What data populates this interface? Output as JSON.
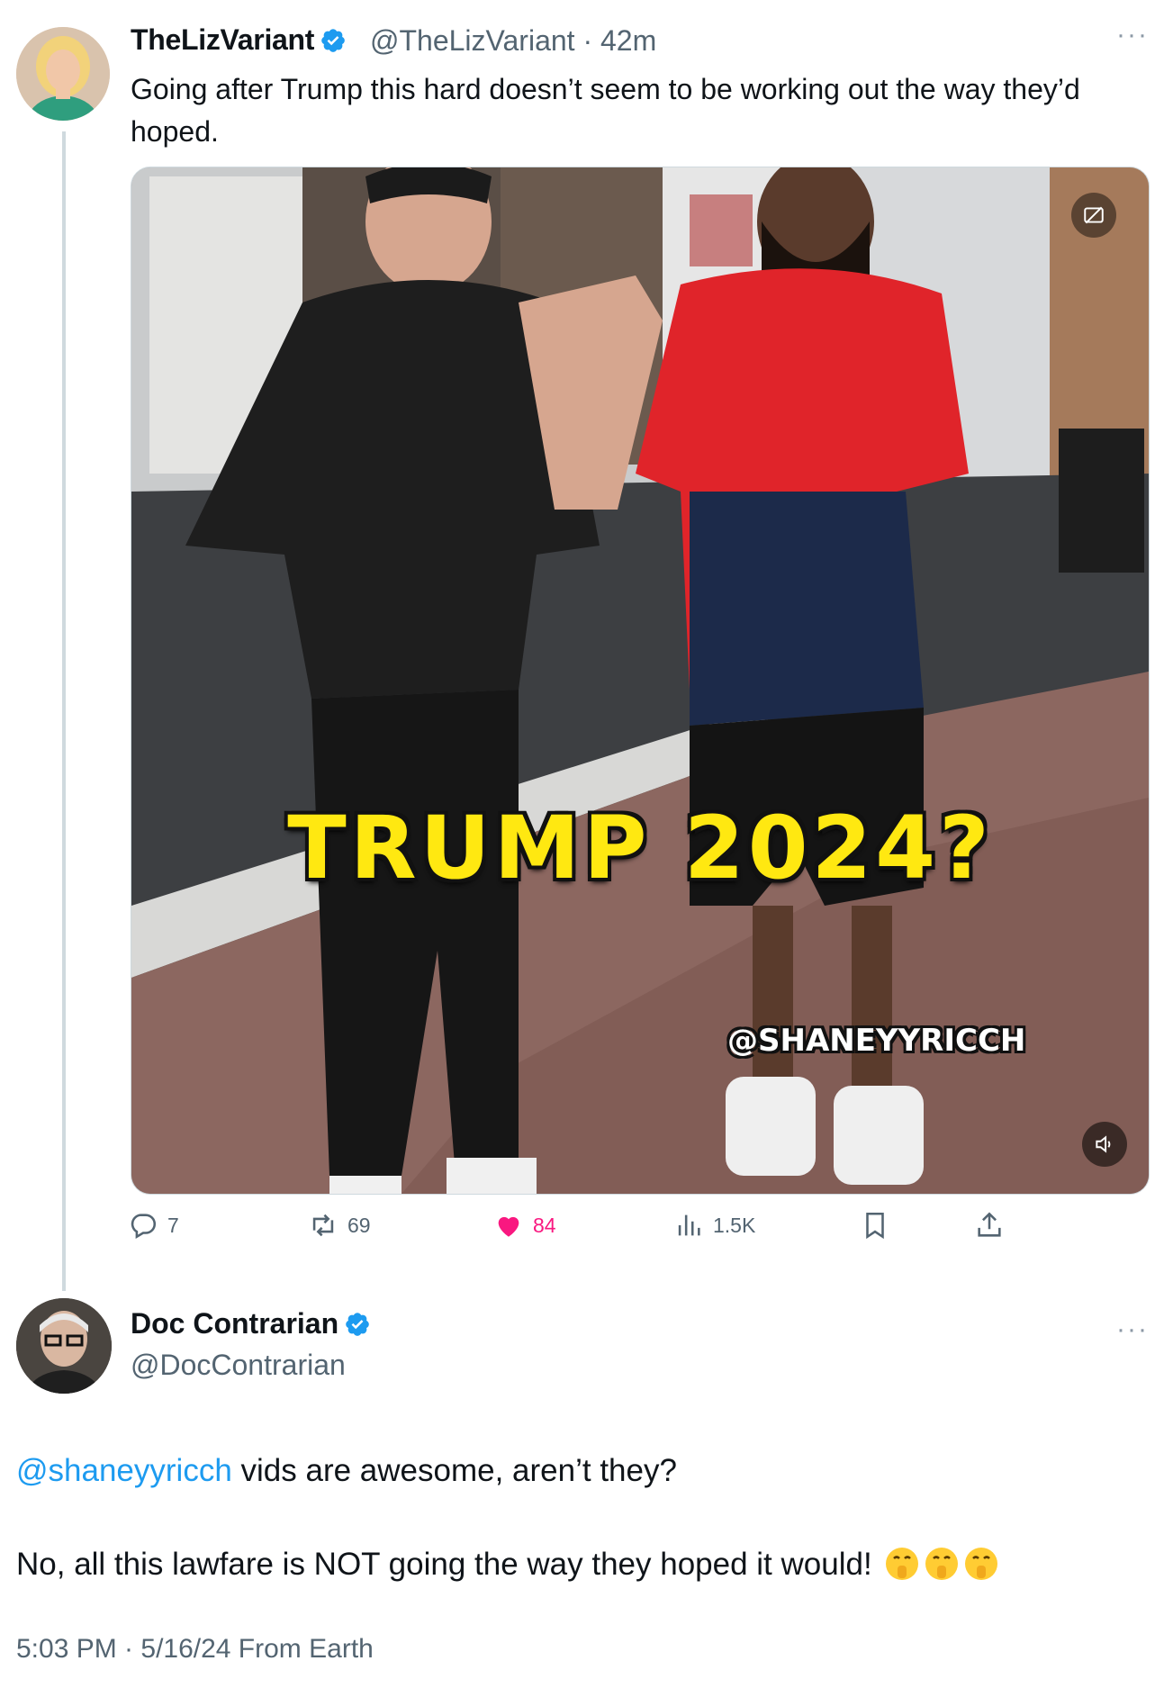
{
  "tweet1": {
    "author_name": "TheLizVariant",
    "handle": "@TheLizVariant",
    "time": "42m",
    "text": "Going after Trump this hard doesn’t seem to be working out the way they’d hoped.",
    "media": {
      "overlay_text": "TRUMP 2024?",
      "overlay_handle": "@SHANEYYRICCH"
    },
    "actions": {
      "replies": "7",
      "reposts": "69",
      "likes": "84",
      "views": "1.5K"
    }
  },
  "tweet2": {
    "author_name": "Doc Contrarian",
    "handle": "@DocContrarian",
    "mention": "@shaneyyricch",
    "text_line1_rest": " vids are awesome, aren’t they?",
    "text_line2": "No, all this lawfare is NOT going the way they hoped it would!",
    "timestamp": "5:03 PM · 5/16/24 From Earth"
  },
  "colors": {
    "link": "#1d9bf0",
    "like": "#f91880",
    "muted": "#536471",
    "verified": "#1d9bf0"
  },
  "icons": [
    "verified-badge-icon",
    "more-icon",
    "reply-icon",
    "repost-icon",
    "like-icon",
    "views-icon",
    "bookmark-icon",
    "share-icon",
    "gif-off-icon",
    "volume-icon",
    "shush-emoji-icon"
  ]
}
